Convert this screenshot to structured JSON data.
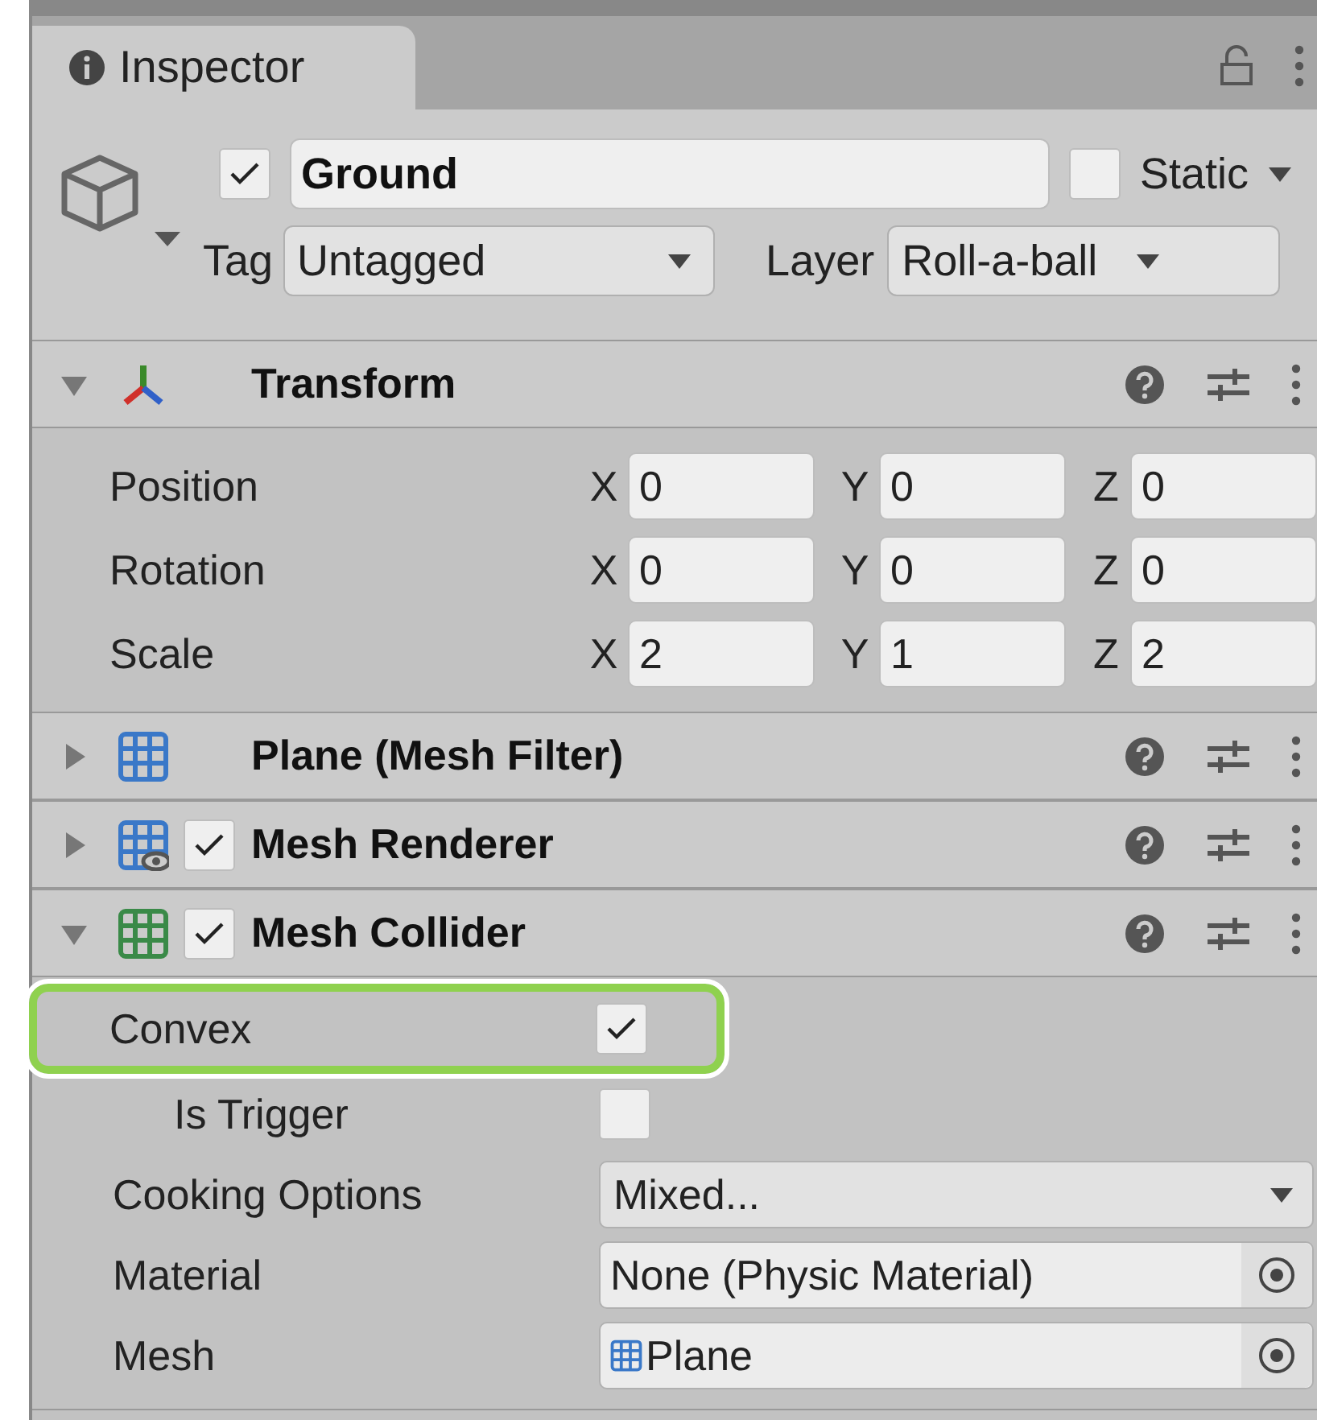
{
  "tab": {
    "title": "Inspector"
  },
  "object": {
    "active": true,
    "name": "Ground",
    "static": false,
    "static_label": "Static",
    "tag_label": "Tag",
    "tag": "Untagged",
    "layer_label": "Layer",
    "layer": "Roll-a-ball"
  },
  "components": [
    {
      "kind": "transform",
      "title": "Transform",
      "expanded": true,
      "rows": [
        {
          "label": "Position",
          "fields": [
            {
              "axis": "X",
              "value": "0"
            },
            {
              "axis": "Y",
              "value": "0"
            },
            {
              "axis": "Z",
              "value": "0"
            }
          ]
        },
        {
          "label": "Rotation",
          "fields": [
            {
              "axis": "X",
              "value": "0"
            },
            {
              "axis": "Y",
              "value": "0"
            },
            {
              "axis": "Z",
              "value": "0"
            }
          ]
        },
        {
          "label": "Scale",
          "fields": [
            {
              "axis": "X",
              "value": "2"
            },
            {
              "axis": "Y",
              "value": "1"
            },
            {
              "axis": "Z",
              "value": "2"
            }
          ]
        }
      ]
    },
    {
      "kind": "filter",
      "title": "Plane (Mesh Filter)",
      "expanded": false
    },
    {
      "kind": "renderer",
      "title": "Mesh Renderer",
      "expanded": false,
      "enabled": true
    },
    {
      "kind": "collider",
      "title": "Mesh Collider",
      "expanded": true,
      "enabled": true,
      "properties": [
        {
          "kind": "checkbox",
          "label": "Convex",
          "checked": true,
          "highlighted": true,
          "children": [
            {
              "kind": "checkbox",
              "label": "Is Trigger",
              "checked": false,
              "highlighted": false
            }
          ]
        },
        {
          "kind": "dropdown",
          "label": "Cooking Options",
          "value": "Mixed..."
        },
        {
          "kind": "object",
          "label": "Material",
          "value": "None (Physic Material)"
        },
        {
          "kind": "mesh_object",
          "label": "Mesh",
          "value": "Plane"
        }
      ]
    }
  ]
}
